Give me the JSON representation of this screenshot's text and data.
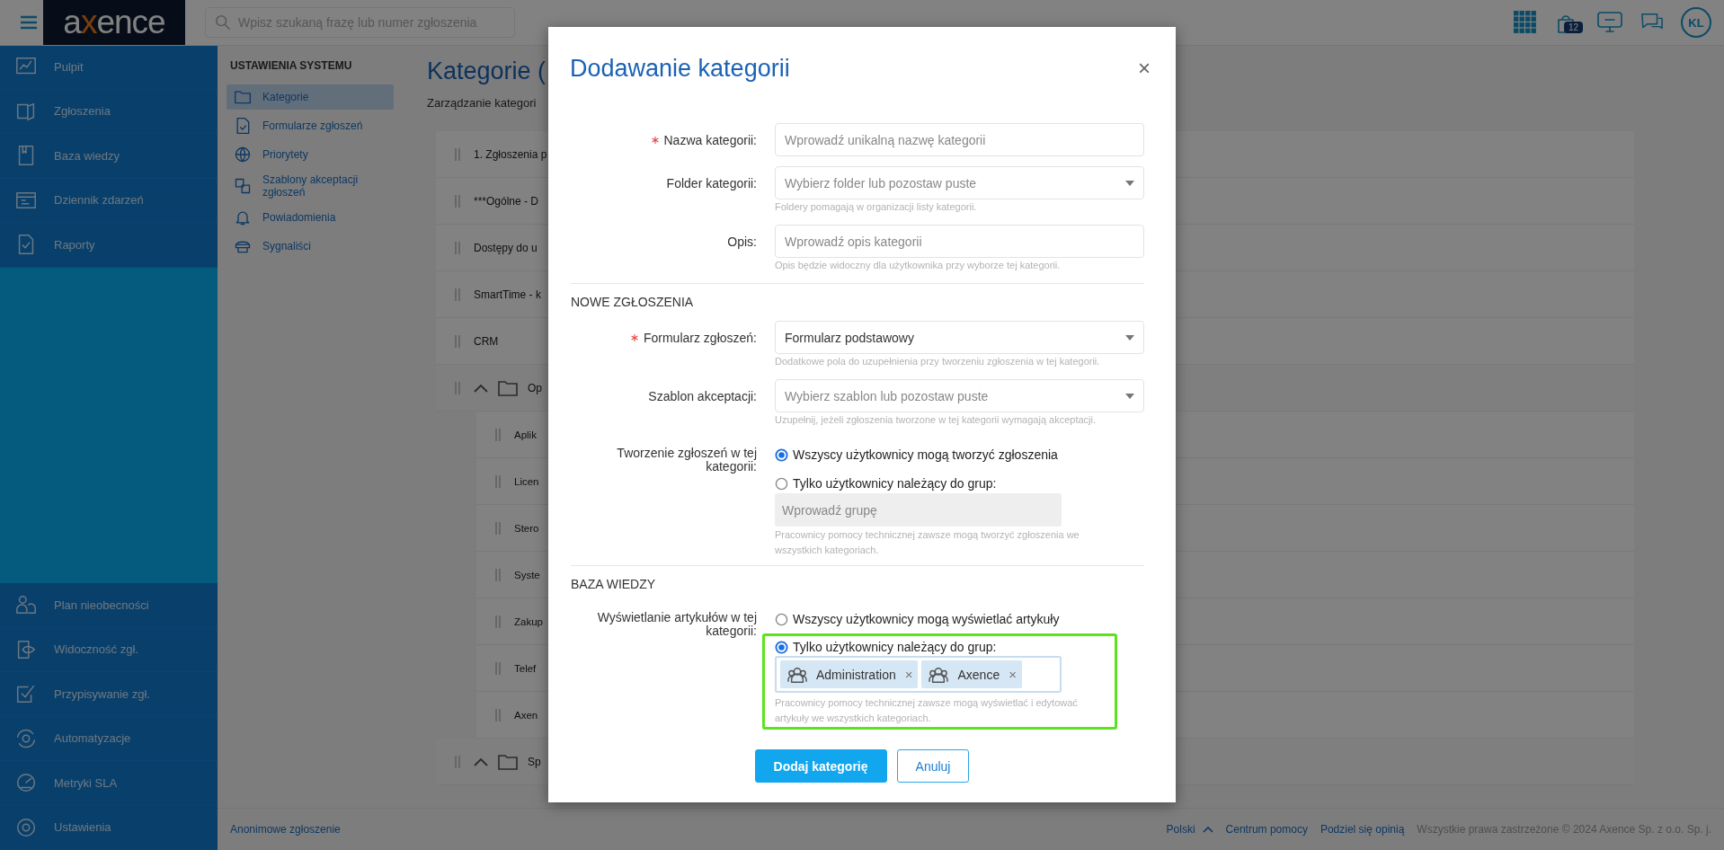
{
  "topbar": {
    "logo": "axence",
    "search": {
      "placeholder": "Wpisz szukaną frazę lub numer zgłoszenia"
    },
    "badge": "12",
    "avatar": "KL"
  },
  "sidebar": {
    "top_items": [
      {
        "label": "Pulpit"
      },
      {
        "label": "Zgłoszenia"
      },
      {
        "label": "Baza wiedzy"
      },
      {
        "label": "Dziennik zdarzeń"
      },
      {
        "label": "Raporty"
      }
    ],
    "bottom_items": [
      {
        "label": "Plan nieobecności"
      },
      {
        "label": "Widoczność zgł."
      },
      {
        "label": "Przypisywanie zgł."
      },
      {
        "label": "Automatyzacje"
      },
      {
        "label": "Metryki SLA"
      },
      {
        "label": "Ustawienia"
      }
    ]
  },
  "settings_menu": {
    "title": "USTAWIENIA SYSTEMU",
    "items": [
      {
        "label": "Kategorie",
        "selected": true
      },
      {
        "label": "Formularze zgłoszeń",
        "selected": false
      },
      {
        "label": "Priorytety",
        "selected": false
      },
      {
        "label": "Szablony akceptacji zgłoszeń",
        "selected": false
      },
      {
        "label": "Powiadomienia",
        "selected": false
      },
      {
        "label": "Sygnaliści",
        "selected": false
      }
    ]
  },
  "page": {
    "title": "Kategorie (",
    "subtitle": "Zarządzanie kategori",
    "rows": [
      {
        "kind": "category",
        "label": "1. Zgłoszenia p"
      },
      {
        "kind": "category",
        "label": "***Ogólne - D"
      },
      {
        "kind": "category",
        "label": "Dostępy do u"
      },
      {
        "kind": "category",
        "label": "SmartTime - k"
      },
      {
        "kind": "category",
        "label": "CRM"
      },
      {
        "kind": "folder",
        "label": "Op",
        "expanded": true,
        "children": [
          {
            "label": "Aplik"
          },
          {
            "label": "Licen"
          },
          {
            "label": "Stero"
          },
          {
            "label": "Syste"
          },
          {
            "label": "Zakup"
          },
          {
            "label": "Telef"
          },
          {
            "label": "Axen"
          }
        ]
      },
      {
        "kind": "folder",
        "label": "Sp",
        "expanded": true
      }
    ]
  },
  "footer": {
    "link": "Anonimowe zgłoszenie",
    "language": "Polski",
    "links": [
      "Centrum pomocy",
      "Podziel się opinią"
    ],
    "copyright": "Wszystkie prawa zastrzeżone © 2024 Axence Sp. z o.o. Sp. j."
  },
  "dialog": {
    "title": "Dodawanie kategorii",
    "close": "×",
    "sections": [
      {
        "fields": [
          {
            "kind": "text",
            "label": "Nazwa kategorii:",
            "required": true,
            "placeholder": "Wprowadź unikalną nazwę kategorii"
          },
          {
            "kind": "select",
            "label": "Folder kategorii:",
            "required": false,
            "placeholder": "Wybierz folder lub pozostaw puste",
            "hint": "Foldery pomagają w organizacji listy kategorii."
          },
          {
            "kind": "text",
            "label": "Opis:",
            "required": false,
            "placeholder": "Wprowadź opis kategorii",
            "hint": "Opis będzie widoczny dla użytkownika przy wyborze tej kategorii."
          }
        ]
      },
      {
        "heading": "NOWE ZGŁOSZENIA",
        "fields": [
          {
            "kind": "select",
            "label": "Formularz zgłoszeń:",
            "required": true,
            "value": "Formularz podstawowy",
            "hint": "Dodatkowe pola do uzupełnienia przy tworzeniu zgłoszenia w tej kategorii."
          },
          {
            "kind": "select",
            "label": "Szablon akceptacji:",
            "required": false,
            "placeholder": "Wybierz szablon lub pozostaw puste",
            "hint": "Uzupełnij, jeżeli zgłoszenia tworzone w tej kategorii wymagają akceptacji."
          },
          {
            "kind": "radio",
            "label": "Tworzenie zgłoszeń w tej kategorii:",
            "highlighted": false,
            "options": [
              {
                "label": "Wszyscy użytkownicy mogą tworzyć zgłoszenia",
                "selected": true
              },
              {
                "label": "Tylko użytkownicy należący do grup:",
                "selected": false,
                "group_field": {
                  "placeholder": "Wprowadź grupę",
                  "disabled": true
                }
              }
            ],
            "hint": "Pracownicy pomocy technicznej zawsze mogą tworzyć zgłoszenia we wszystkich kategoriach."
          }
        ]
      },
      {
        "heading": "BAZA WIEDZY",
        "fields": [
          {
            "kind": "radio",
            "label": "Wyświetlanie artykułów w tej kategorii:",
            "highlighted": true,
            "options": [
              {
                "label": "Wszyscy użytkownicy mogą wyświetlać artykuły",
                "selected": false
              },
              {
                "label": "Tylko użytkownicy należący do grup:",
                "selected": true,
                "group_field": {
                  "disabled": false,
                  "tags": [
                    {
                      "label": "Administration",
                      "remove": "×"
                    },
                    {
                      "label": "Axence",
                      "remove": "×"
                    }
                  ]
                }
              }
            ],
            "hint": "Pracownicy pomocy technicznej zawsze mogą wyświetlać i edytować artykuły we wszystkich kategoriach."
          }
        ]
      }
    ],
    "buttons": [
      {
        "label": "Dodaj kategorię",
        "kind": "primary"
      },
      {
        "label": "Anuluj",
        "kind": "secondary"
      }
    ]
  }
}
